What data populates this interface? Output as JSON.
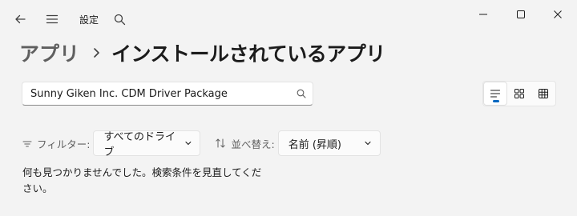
{
  "titlebar": {
    "app_title": "設定",
    "back_icon": "back-arrow-icon",
    "menu_icon": "hamburger-menu-icon",
    "search_icon": "search-icon",
    "minimize_icon": "minimize-icon",
    "maximize_icon": "maximize-icon",
    "close_icon": "close-icon"
  },
  "breadcrumb": {
    "root": "アプリ",
    "current": "インストールされているアプリ"
  },
  "search": {
    "value": "Sunny Giken Inc. CDM Driver Package"
  },
  "view_toggle": {
    "selected": "list",
    "options": [
      "list",
      "tiles",
      "grid"
    ]
  },
  "filter": {
    "label": "フィルター:",
    "selected": "すべてのドライブ"
  },
  "sort": {
    "label": "並べ替え:",
    "selected": "名前 (昇順)"
  },
  "message": "何も見つかりませんでした。検索条件を見直してください。",
  "colors": {
    "background": "#f3f3f3",
    "accent": "#0067c0",
    "text": "#1b1b1b",
    "secondary_text": "#5f5f5f"
  }
}
